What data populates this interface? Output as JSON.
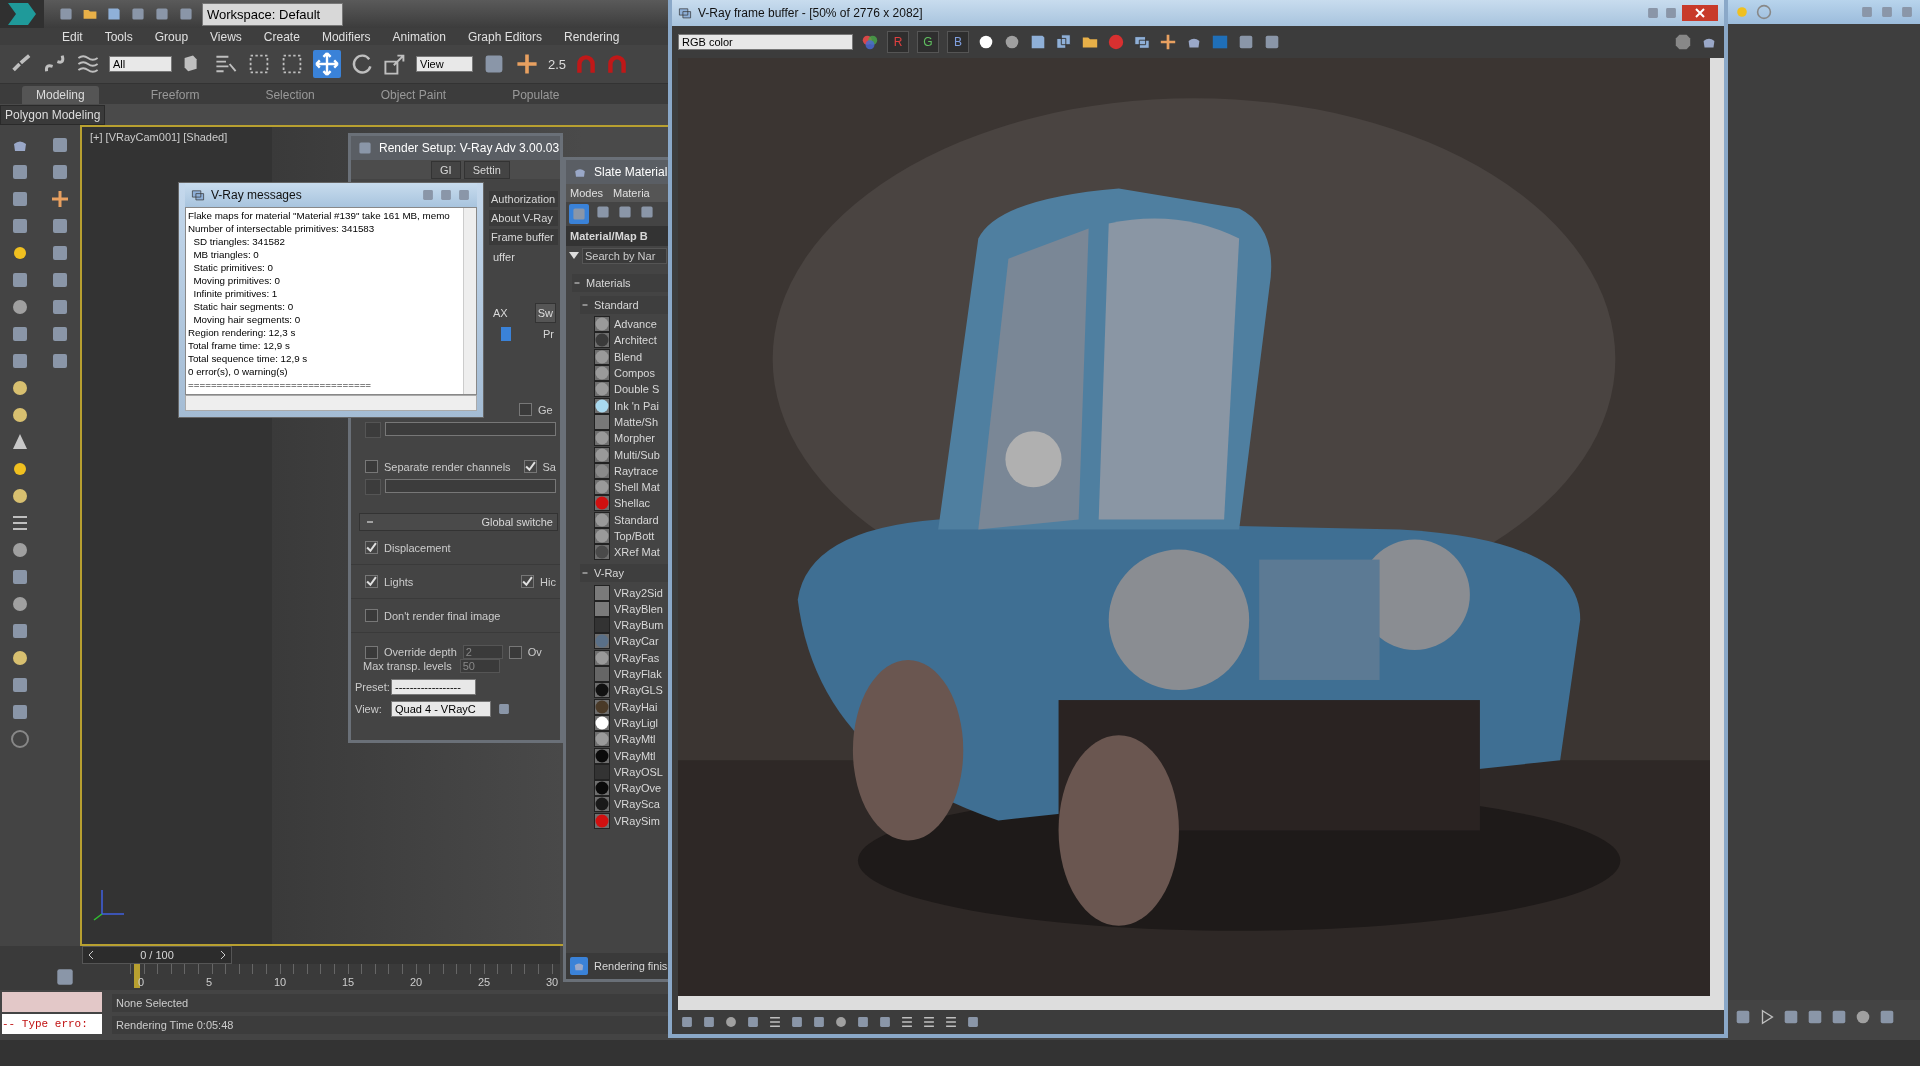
{
  "quick_access": {
    "workspace": "Workspace: Default"
  },
  "menu_bar": [
    "Edit",
    "Tools",
    "Group",
    "Views",
    "Create",
    "Modifiers",
    "Animation",
    "Graph Editors",
    "Rendering"
  ],
  "main_toolbar": {
    "selection_filter": "All",
    "reference_coordinate": "View",
    "snap_value": "2.5"
  },
  "ribbon_tabs": [
    {
      "label": "Modeling",
      "selected": true
    },
    {
      "label": "Freeform",
      "selected": false
    },
    {
      "label": "Selection",
      "selected": false
    },
    {
      "label": "Object Paint",
      "selected": false
    },
    {
      "label": "Populate",
      "selected": false
    }
  ],
  "ribbon_panel": "Polygon Modeling",
  "viewport": {
    "label": "[+] [VRayCam001] [Shaded]"
  },
  "time_slider": {
    "value": "0 / 100"
  },
  "timeline_ticks": [
    "0",
    "5",
    "10",
    "15",
    "20",
    "25",
    "30"
  ],
  "status_bar": {
    "listener_output": "-- Type erro:",
    "selection": "None Selected",
    "prompt": "Rendering Time  0:05:48"
  },
  "vray_messages": {
    "title": "V-Ray messages",
    "lines": [
      "Flake maps for material \"Material #139\" take 161 MB, memo",
      "Number of intersectable primitives: 341583",
      "  SD triangles: 341582",
      "  MB triangles: 0",
      "  Static primitives: 0",
      "  Moving primitives: 0",
      "  Infinite primitives: 1",
      "  Static hair segments: 0",
      "  Moving hair segments: 0",
      "Region rendering: 12,3 s",
      "Total frame time: 12,9 s",
      "Total sequence time: 12,9 s",
      "0 error(s), 0 warning(s)",
      "================================"
    ]
  },
  "render_setup": {
    "title": "Render Setup: V-Ray Adv 3.00.03",
    "tabs": [
      "GI",
      "Settin"
    ],
    "rollout_buttons": [
      "Authorization",
      "About V-Ray",
      "Frame buffer"
    ],
    "partial_labels": [
      "uffer",
      "AX",
      "Pr"
    ],
    "swatch_button": "Sw",
    "options": [
      {
        "label": "Ge",
        "checked": false
      },
      {
        "label": "Separate render channels",
        "checked": false
      },
      {
        "label": "Sa",
        "checked": true
      }
    ],
    "global_switches": {
      "title": "Global switche",
      "expanded": true,
      "options": [
        {
          "label": "Displacement",
          "checked": true
        },
        {
          "label": "Lights",
          "checked": true
        },
        {
          "label": "Hic",
          "checked": true
        },
        {
          "label": "Don't render final image",
          "checked": false
        },
        {
          "label": "Override depth",
          "checked": false
        },
        {
          "label": "Ov",
          "checked": false
        }
      ],
      "override_depth": "2",
      "max_transp_label": "Max transp. levels",
      "max_transp": "50"
    },
    "preset_label": "Preset:",
    "preset": "------------------",
    "view_label": "View:",
    "view": "Quad 4 - VRayC"
  },
  "slate_editor": {
    "title": "Slate Material",
    "menus": [
      "Modes",
      "Materia"
    ],
    "browser_title": "Material/Map B",
    "search_placeholder": "Search by Nar",
    "tree": [
      {
        "label": "Materials",
        "expanded": true,
        "children": [
          {
            "label": "Standard",
            "expanded": true,
            "children": [
              {
                "label": "Advance",
                "kind": "sphere",
                "color": "#9a9a9a"
              },
              {
                "label": "Architect",
                "kind": "sphere",
                "color": "#3a3a3a"
              },
              {
                "label": "Blend",
                "kind": "sphere",
                "color": "#9a9a9a"
              },
              {
                "label": "Compos",
                "kind": "sphere",
                "color": "#9a9a9a"
              },
              {
                "label": "Double S",
                "kind": "sphere",
                "color": "#9a9a9a"
              },
              {
                "label": "Ink 'n Pai",
                "kind": "sphere",
                "color": "#a8d8ee"
              },
              {
                "label": "Matte/Sh",
                "kind": "flat",
                "color": "#787878"
              },
              {
                "label": "Morpher",
                "kind": "sphere",
                "color": "#9a9a9a"
              },
              {
                "label": "Multi/Sub",
                "kind": "sphere",
                "color": "#9a9a9a"
              },
              {
                "label": "Raytrace",
                "kind": "sphere",
                "color": "#8a8a8a"
              },
              {
                "label": "Shell Mat",
                "kind": "sphere",
                "color": "#9a9a9a"
              },
              {
                "label": "Shellac",
                "kind": "sphere",
                "color": "#d01010"
              },
              {
                "label": "Standard",
                "kind": "sphere",
                "color": "#9a9a9a"
              },
              {
                "label": "Top/Bott",
                "kind": "sphere",
                "color": "#9a9a9a"
              },
              {
                "label": "XRef Mat",
                "kind": "sphere",
                "color": "#4a4a4a"
              }
            ]
          },
          {
            "label": "V-Ray",
            "expanded": true,
            "children": [
              {
                "label": "VRay2Sid",
                "kind": "flat",
                "color": "#7a7a7a"
              },
              {
                "label": "VRayBlen",
                "kind": "flat",
                "color": "#7a7a7a"
              },
              {
                "label": "VRayBum",
                "kind": "flat",
                "color": "#333333"
              },
              {
                "label": "VRayCar",
                "kind": "sphere",
                "color": "#5a7088"
              },
              {
                "label": "VRayFas",
                "kind": "sphere",
                "color": "#9a9a9a"
              },
              {
                "label": "VRayFlak",
                "kind": "flat",
                "color": "#666666"
              },
              {
                "label": "VRayGLS",
                "kind": "sphere",
                "color": "#111111"
              },
              {
                "label": "VRayHai",
                "kind": "sphere",
                "color": "#4a3a28"
              },
              {
                "label": "VRayLigl",
                "kind": "sphere",
                "color": "#ffffff"
              },
              {
                "label": "VRayMtl",
                "kind": "sphere",
                "color": "#9a9a9a"
              },
              {
                "label": "VRayMtl",
                "kind": "sphere",
                "color": "#0a0a0a"
              },
              {
                "label": "VRayOSL",
                "kind": "flat",
                "color": "#333333"
              },
              {
                "label": "VRayOve",
                "kind": "sphere",
                "color": "#0a0a0a"
              },
              {
                "label": "VRaySca",
                "kind": "sphere",
                "color": "#1a1a1a"
              },
              {
                "label": "VRaySim",
                "kind": "sphere",
                "color": "#d01010"
              }
            ]
          }
        ]
      }
    ],
    "status": "Rendering finis"
  },
  "frame_buffer": {
    "title": "V-Ray frame buffer - [50% of 2776 x 2082]",
    "channel": "RGB color",
    "channel_buttons": [
      "R",
      "G",
      "B"
    ]
  }
}
